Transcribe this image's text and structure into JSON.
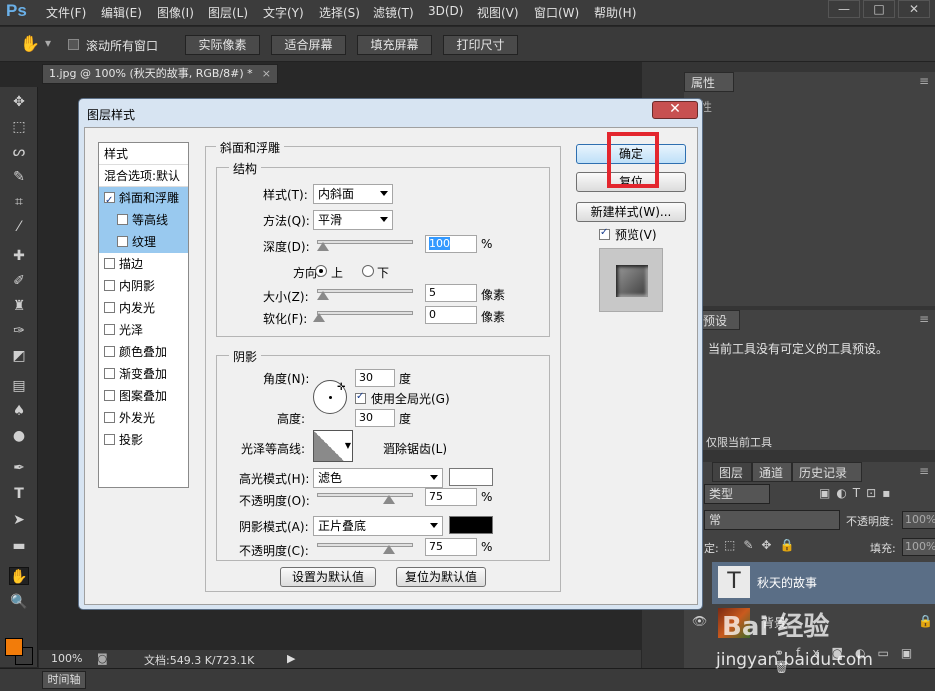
{
  "app": {
    "logo": "Ps",
    "menu": [
      "文件(F)",
      "编辑(E)",
      "图像(I)",
      "图层(L)",
      "文字(Y)",
      "选择(S)",
      "滤镜(T)",
      "3D(D)",
      "视图(V)",
      "窗口(W)",
      "帮助(H)"
    ],
    "window_buttons": [
      "—",
      "□",
      "✕"
    ]
  },
  "options_bar": {
    "scroll_all_label": "滚动所有窗口",
    "buttons": [
      "实际像素",
      "适合屏幕",
      "填充屏幕",
      "打印尺寸"
    ]
  },
  "document": {
    "tab_label": "1.jpg @ 100% (秋天的故事, RGB/8#) *",
    "zoom": "100%",
    "doc_size": "文档:549.3 K/723.1K"
  },
  "timeline_label": "时间轴",
  "right_panels": {
    "properties_tab": "属性",
    "properties_title": "属性",
    "tool_presets_tab": "具预设",
    "tool_presets_msg": "当前工具没有可定义的工具预设。",
    "current_tool_only": "仅限当前工具",
    "layer_tabs": [
      "图层",
      "通道",
      "历史记录"
    ],
    "kind_label": "类型",
    "blend_mode": "常",
    "opacity_label": "不透明度:",
    "opacity_value": "100%",
    "lock_label": "定:",
    "fill_label": "填充:",
    "fill_value": "100%",
    "layers": [
      {
        "name": "秋天的故事",
        "type": "text"
      },
      {
        "name": "背景",
        "type": "image"
      }
    ]
  },
  "dialog": {
    "title": "图层样式",
    "close": "✕",
    "styles_header": "样式",
    "blend_options": "混合选项:默认",
    "style_items": [
      {
        "label": "斜面和浮雕",
        "checked": true,
        "selected": true,
        "sub": false
      },
      {
        "label": "等高线",
        "checked": false,
        "selected": true,
        "sub": true
      },
      {
        "label": "纹理",
        "checked": false,
        "selected": true,
        "sub": true
      },
      {
        "label": "描边",
        "checked": false,
        "selected": false,
        "sub": false
      },
      {
        "label": "内阴影",
        "checked": false,
        "selected": false,
        "sub": false
      },
      {
        "label": "内发光",
        "checked": false,
        "selected": false,
        "sub": false
      },
      {
        "label": "光泽",
        "checked": false,
        "selected": false,
        "sub": false
      },
      {
        "label": "颜色叠加",
        "checked": false,
        "selected": false,
        "sub": false
      },
      {
        "label": "渐变叠加",
        "checked": false,
        "selected": false,
        "sub": false
      },
      {
        "label": "图案叠加",
        "checked": false,
        "selected": false,
        "sub": false
      },
      {
        "label": "外发光",
        "checked": false,
        "selected": false,
        "sub": false
      },
      {
        "label": "投影",
        "checked": false,
        "selected": false,
        "sub": false
      }
    ],
    "section_title": "斜面和浮雕",
    "structure_title": "结构",
    "style_label": "样式(T):",
    "style_value": "内斜面",
    "technique_label": "方法(Q):",
    "technique_value": "平滑",
    "depth_label": "深度(D):",
    "depth_value": "100",
    "depth_level": 0.05,
    "depth_unit": "%",
    "direction_label": "方向:",
    "direction_up": "上",
    "direction_down": "下",
    "size_label": "大小(Z):",
    "size_value": "5",
    "size_unit": "像素",
    "soften_label": "软化(F):",
    "soften_value": "0",
    "soften_unit": "像素",
    "shading_title": "阴影",
    "angle_label": "角度(N):",
    "angle_value": "30",
    "angle_unit": "度",
    "global_light_label": "使用全局光(G)",
    "altitude_label": "高度:",
    "altitude_value": "30",
    "altitude_unit": "度",
    "gloss_contour_label": "光泽等高线:",
    "antialiased_label": "消除锯齿(L)",
    "highlight_mode_label": "高光模式(H):",
    "highlight_mode_value": "滤色",
    "highlight_color": "#ffffff",
    "highlight_opacity_label": "不透明度(O):",
    "highlight_opacity_value": "75",
    "highlight_opacity_unit": "%",
    "shadow_mode_label": "阴影模式(A):",
    "shadow_mode_value": "正片叠底",
    "shadow_color": "#000000",
    "shadow_opacity_label": "不透明度(C):",
    "shadow_opacity_value": "75",
    "shadow_opacity_unit": "%",
    "make_default": "设置为默认值",
    "reset_default": "复位为默认值",
    "ok": "确定",
    "reset": "复位",
    "new_style": "新建样式(W)...",
    "preview_label": "预览(V)"
  },
  "watermark": "Bai 经验",
  "watermark_url": "jingyan.baidu.com",
  "colors": {
    "accent_red": "#e3262e",
    "foreground": "#f27c0a",
    "background": "#ffffff"
  }
}
